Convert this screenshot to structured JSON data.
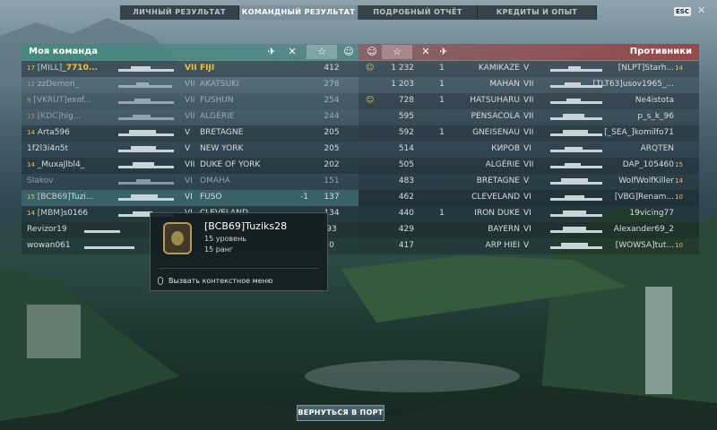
{
  "tabs": [
    {
      "label": "ЛИЧНЫЙ РЕЗУЛЬТАТ",
      "active": false
    },
    {
      "label": "КОМАНДНЫЙ РЕЗУЛЬТАТ",
      "active": true
    },
    {
      "label": "ПОДРОБНЫЙ ОТЧЁТ",
      "active": false
    },
    {
      "label": "КРЕДИТЫ И ОПЫТ",
      "active": false
    }
  ],
  "esc_label": "ESC",
  "close_glyph": "✕",
  "my_team": {
    "title": "Моя команда",
    "rows": [
      {
        "rank": "17",
        "clan": "[MILL]",
        "name": "_7710...",
        "tier": "VII",
        "ship": "FIJI",
        "damage": "",
        "exp": "412",
        "gold": true
      },
      {
        "rank": "12",
        "clan": "",
        "name": "zzDemon_",
        "tier": "VII",
        "ship": "AKATSUKI",
        "damage": "",
        "exp": "278",
        "dim": true
      },
      {
        "rank": "9",
        "clan": "[VKRUT]",
        "name": "exof...",
        "tier": "VII",
        "ship": "FUSHUN",
        "damage": "",
        "exp": "254",
        "dim": true
      },
      {
        "rank": "15",
        "clan": "[KDC]",
        "name": "hig...",
        "tier": "VII",
        "ship": "ALGÉRIE",
        "damage": "",
        "exp": "244",
        "dim": true
      },
      {
        "rank": "14",
        "clan": "",
        "name": "Arta596",
        "tier": "V",
        "ship": "BRETAGNE",
        "damage": "",
        "exp": "205"
      },
      {
        "rank": "",
        "clan": "",
        "name": "1f2l3i4n5t",
        "tier": "V",
        "ship": "NEW YORK",
        "damage": "",
        "exp": "205"
      },
      {
        "rank": "14",
        "clan": "",
        "name": "_MuxaJlbl4_",
        "tier": "VII",
        "ship": "DUKE OF YORK",
        "damage": "",
        "exp": "202"
      },
      {
        "rank": "",
        "clan": "",
        "name": "Slakov",
        "tier": "VI",
        "ship": "OMAHA",
        "damage": "",
        "exp": "151",
        "dim": true
      },
      {
        "rank": "15",
        "clan": "[BCB69]",
        "name": "Tuzi...",
        "tier": "VI",
        "ship": "FUSO",
        "damage": "-1",
        "exp": "137",
        "sel": true
      },
      {
        "rank": "14",
        "clan": "[MBM]",
        "name": "s0166",
        "tier": "VI",
        "ship": "CLEVELAND",
        "damage": "",
        "exp": "134"
      },
      {
        "rank": "",
        "clan": "",
        "name": "Revizor19",
        "tier": "",
        "ship": "",
        "damage": "",
        "exp": "93"
      },
      {
        "rank": "",
        "clan": "",
        "name": "wowan061",
        "tier": "",
        "ship": "",
        "damage": "",
        "exp": "0"
      }
    ]
  },
  "enemy_team": {
    "title": "Противники",
    "rows": [
      {
        "icon": "☺",
        "exp": "1 232",
        "frags": "1",
        "ship": "KAMIKAZE",
        "tier": "V",
        "player": "[NLPT]Starh...",
        "rank": "14"
      },
      {
        "icon": "",
        "exp": "1 203",
        "frags": "1",
        "ship": "MAHAN",
        "tier": "VII",
        "player": "[TLT63]usov1965_...",
        "rank": ""
      },
      {
        "icon": "☺",
        "exp": "728",
        "frags": "1",
        "ship": "HATSUHARU",
        "tier": "VII",
        "player": "Ne4istota",
        "rank": ""
      },
      {
        "icon": "",
        "exp": "595",
        "frags": "",
        "ship": "PENSACOLA",
        "tier": "VII",
        "player": "p_s_k_96",
        "rank": ""
      },
      {
        "icon": "",
        "exp": "592",
        "frags": "1",
        "ship": "GNEISENAU",
        "tier": "VII",
        "player": "[_SEA_]komilfo71",
        "rank": ""
      },
      {
        "icon": "",
        "exp": "514",
        "frags": "",
        "ship": "КИРОВ",
        "tier": "VI",
        "player": "ARQTEN",
        "rank": ""
      },
      {
        "icon": "",
        "exp": "505",
        "frags": "",
        "ship": "ALGÉRIE",
        "tier": "VII",
        "player": "DAP_105460",
        "rank": "15"
      },
      {
        "icon": "",
        "exp": "483",
        "frags": "",
        "ship": "BRETAGNE",
        "tier": "V",
        "player": "WolfWolfKiller",
        "rank": "14"
      },
      {
        "icon": "",
        "exp": "462",
        "frags": "",
        "ship": "CLEVELAND",
        "tier": "VI",
        "player": "[VBG]Renam...",
        "rank": "10"
      },
      {
        "icon": "",
        "exp": "440",
        "frags": "1",
        "ship": "IRON DUKE",
        "tier": "VI",
        "player": "19vicing77",
        "rank": ""
      },
      {
        "icon": "",
        "exp": "429",
        "frags": "",
        "ship": "BAYERN",
        "tier": "VI",
        "player": "Alexander69_2",
        "rank": ""
      },
      {
        "icon": "",
        "exp": "417",
        "frags": "",
        "ship": "ARP HIEI",
        "tier": "V",
        "player": "[WOWSA]tut...",
        "rank": "10"
      }
    ]
  },
  "tooltip": {
    "name": "[BCB69]Tuziks28",
    "level": "15 уровень",
    "rank": "15 ранг",
    "context": "Вызвать контекстное меню"
  },
  "return_button": "ВЕРНУТЬСЯ В ПОРТ",
  "colors": {
    "ally_header": "#448a7e",
    "enemy_header": "#964646",
    "gold": "#f1c13a"
  }
}
